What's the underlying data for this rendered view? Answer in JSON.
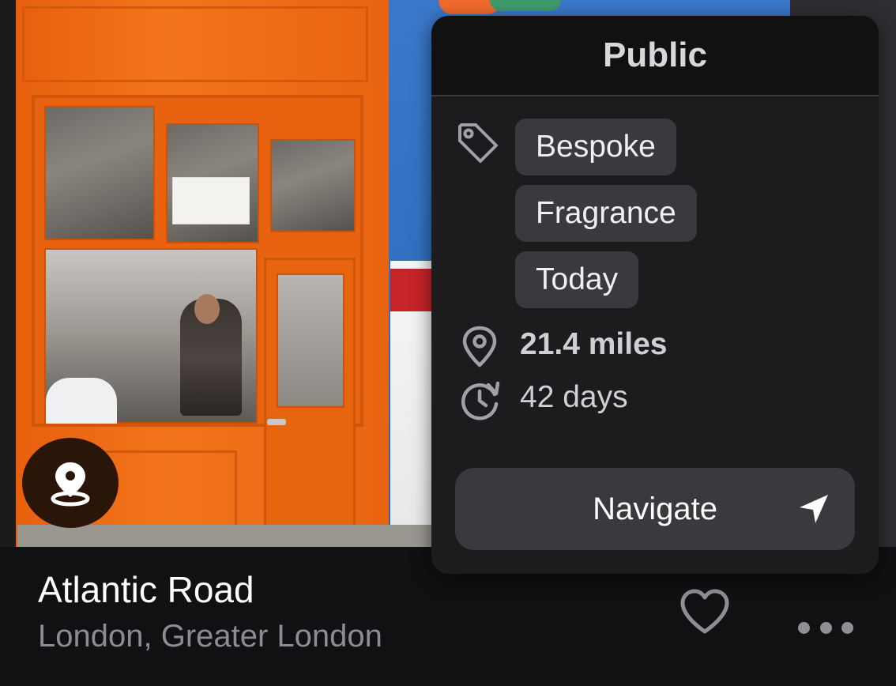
{
  "place": {
    "title": "Atlantic Road",
    "location": "London, Greater London"
  },
  "popover": {
    "title": "Public",
    "tags": [
      "Bespoke",
      "Fragrance",
      "Today"
    ],
    "distance": "21.4 miles",
    "age": "42 days",
    "navigate_label": "Navigate"
  },
  "icons": {
    "pin": "map-pin-icon",
    "tag": "tag-icon",
    "location": "location-icon",
    "history": "clock-history-icon",
    "navigate": "navigation-arrow-icon",
    "favorite": "heart-icon",
    "more": "more-dots-icon"
  },
  "colors": {
    "background": "#111113",
    "popover": "#1c1c1e",
    "chip": "#3a3a3e",
    "pin_button": "#2a1609",
    "storefront": "#f2741a"
  }
}
